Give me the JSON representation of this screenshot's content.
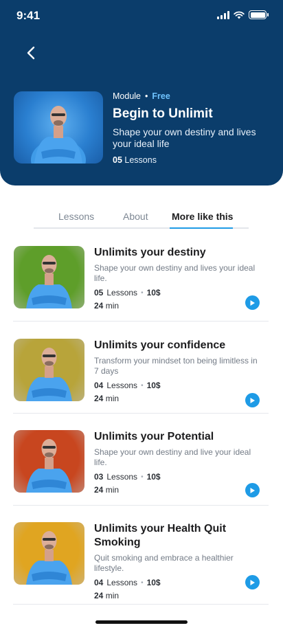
{
  "status_bar": {
    "time": "9:41"
  },
  "header": {
    "module_label": "Module",
    "module_price": "Free",
    "title": "Begin to Unlimit",
    "description": "Shape your own destiny and lives your ideal life",
    "lessons_count": "05",
    "lessons_label": "Lessons"
  },
  "tabs": [
    {
      "label": "Lessons"
    },
    {
      "label": "About"
    },
    {
      "label": "More like this"
    }
  ],
  "active_tab": "More like this",
  "courses": [
    {
      "title": "Unlimits your destiny",
      "description": "Shape your own destiny and lives your ideal life.",
      "lessons_count": "05",
      "lessons_label": "Lessons",
      "price": "10$",
      "duration_value": "24",
      "duration_unit": "min",
      "thumb_color": "#5e9e2a"
    },
    {
      "title": "Unlimits your confidence",
      "description": "Transform your mindset ton being limitless in 7 days",
      "lessons_count": "04",
      "lessons_label": "Lessons",
      "price": "10$",
      "duration_value": "24",
      "duration_unit": "min",
      "thumb_color": "#b8a43a"
    },
    {
      "title": "Unlimits your Potential",
      "description": "Shape your own destiny and live your ideal life.",
      "lessons_count": "03",
      "lessons_label": "Lessons",
      "price": "10$",
      "duration_value": "24",
      "duration_unit": "min",
      "thumb_color": "#c8461f"
    },
    {
      "title": "Unlimits your Health Quit Smoking",
      "description": "Quit smoking and embrace a healthier lifestyle.",
      "lessons_count": "04",
      "lessons_label": "Lessons",
      "price": "10$",
      "duration_value": "24",
      "duration_unit": "min",
      "thumb_color": "#e0a521"
    }
  ],
  "colors": {
    "header_bg": "#0b3d6b",
    "accent": "#1e9be6",
    "free_label": "#6fc3ff"
  }
}
